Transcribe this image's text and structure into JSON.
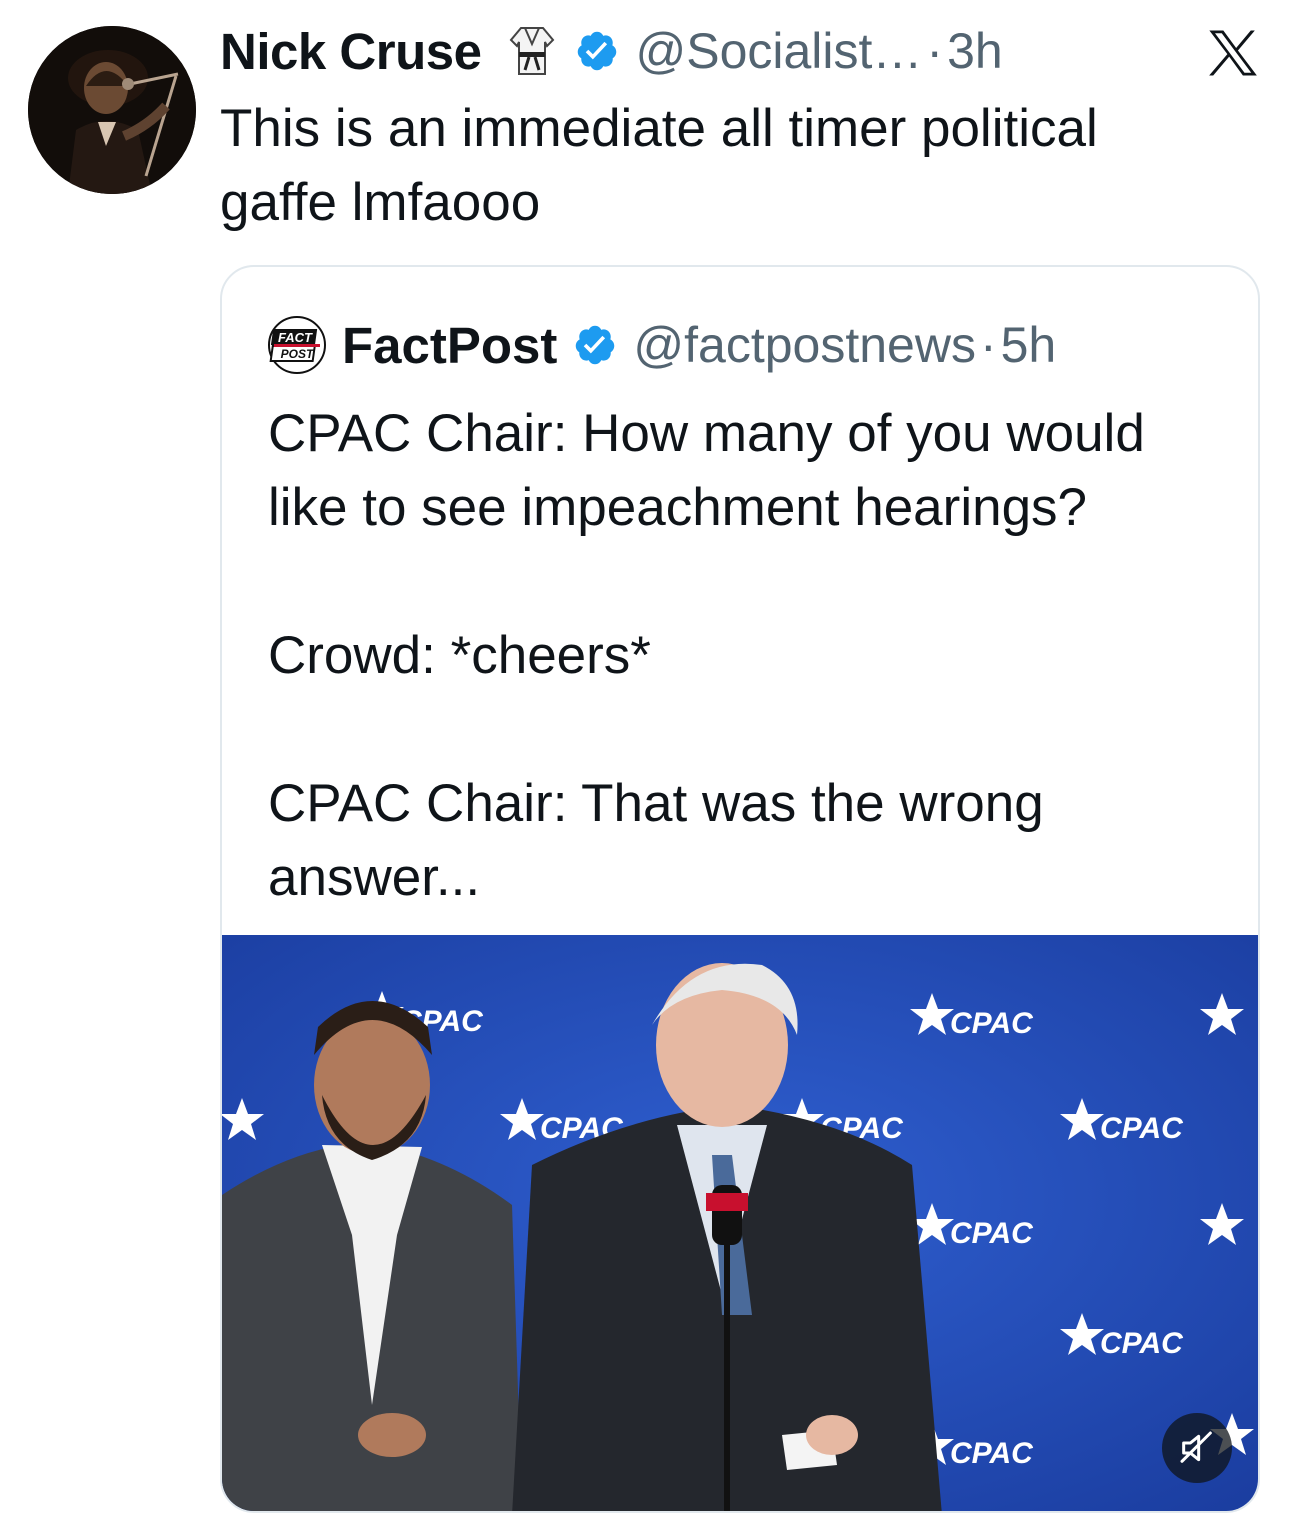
{
  "tweet": {
    "author_name": "Nick Cruse",
    "handle": "@Socialist…",
    "separator": "·",
    "time": "3h",
    "text_line1": "This is an immediate all timer political",
    "text_line2": "gaffe lmfaooo",
    "badge_icon": "karate-gi-icon",
    "verified_icon": "verified-badge-icon",
    "platform_icon": "x-logo-icon"
  },
  "quoted": {
    "author_name": "FactPost",
    "handle": "@factpostnews",
    "separator": "·",
    "time": "5h",
    "logo_line1": "FACT",
    "logo_line2": "POST",
    "para1_line1": "CPAC Chair: How many of you would",
    "para1_line2": "like to see impeachment hearings?",
    "para2": "Crowd: *cheers*",
    "para3_line1": "CPAC Chair: That was the wrong",
    "para3_line2": "answer...",
    "media": {
      "backdrop_label": "CPAC",
      "mute_icon": "speaker-muted-icon"
    }
  },
  "colors": {
    "text": "#0f1419",
    "secondary": "#536471",
    "verified": "#1d9bf0",
    "border": "#e1e8ed",
    "backdrop_blue": "#1f48b8"
  }
}
